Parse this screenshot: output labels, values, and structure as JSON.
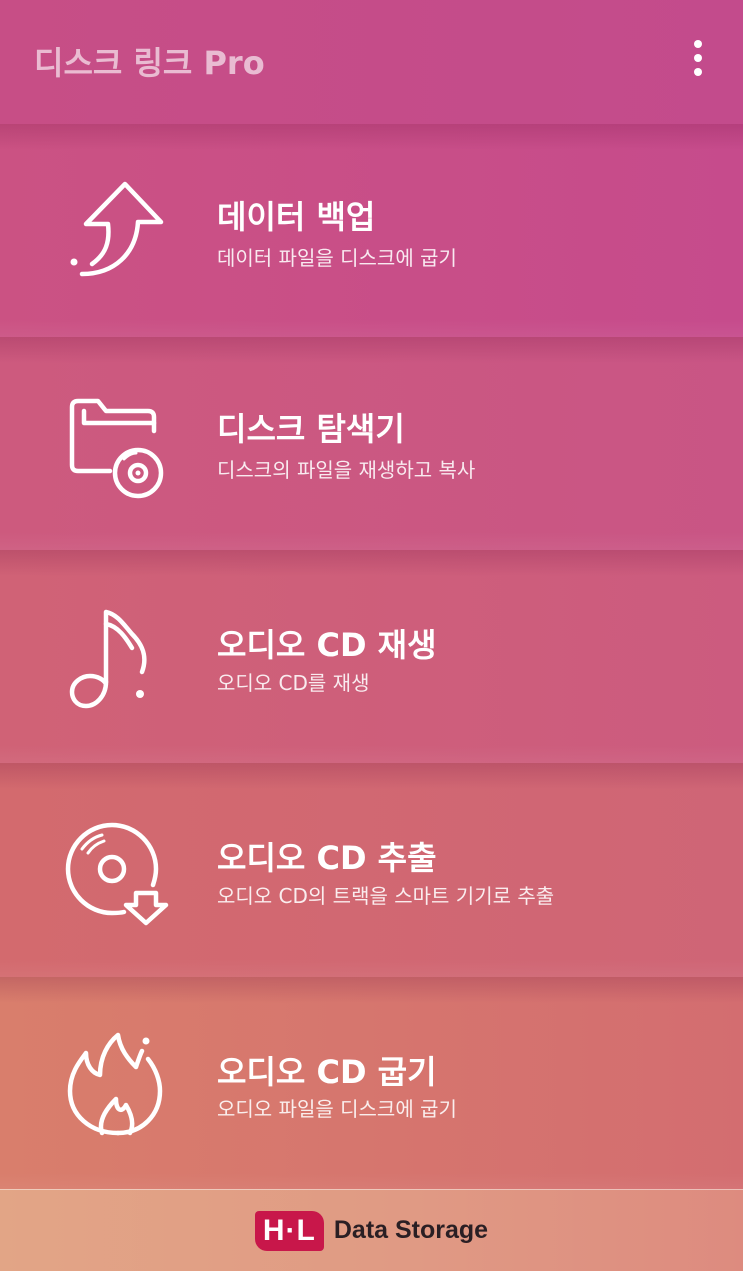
{
  "app": {
    "title": "디스크 링크 Pro",
    "menu_icon": "more-vert-icon"
  },
  "menu": [
    {
      "title": "데이터 백업",
      "subtitle": "데이터 파일을 디스크에 굽기",
      "icon": "upload-arrow-icon"
    },
    {
      "title": "디스크 탐색기",
      "subtitle": "디스크의 파일을 재생하고 복사",
      "icon": "folder-disc-icon"
    },
    {
      "title": "오디오 CD 재생",
      "subtitle": "오디오 CD를 재생",
      "icon": "music-note-icon"
    },
    {
      "title": "오디오 CD 추출",
      "subtitle": "오디오 CD의 트랙을 스마트 기기로 추출",
      "icon": "disc-download-icon"
    },
    {
      "title": "오디오 CD 굽기",
      "subtitle": "오디오 파일을 디스크에 굽기",
      "icon": "flame-icon"
    }
  ],
  "footer": {
    "brand_mark": "H·L",
    "brand_text": "Data Storage"
  },
  "colors": {
    "brand": "#c8174a",
    "appbar": "#c64c8a"
  }
}
